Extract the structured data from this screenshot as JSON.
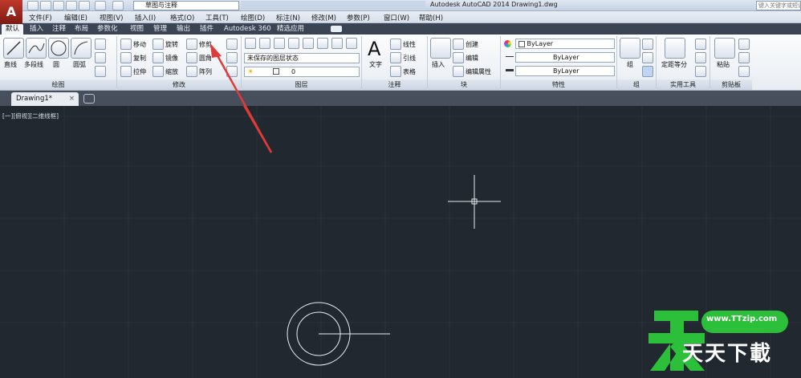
{
  "titlebar": {
    "workspace": "草图与注释",
    "title": "Autodesk AutoCAD 2014    Drawing1.dwg",
    "search_placeholder": "键入关键字或短语"
  },
  "menu": [
    "文件(F)",
    "编辑(E)",
    "视图(V)",
    "插入(I)",
    "格式(O)",
    "工具(T)",
    "绘图(D)",
    "标注(N)",
    "修改(M)",
    "参数(P)",
    "窗口(W)",
    "帮助(H)"
  ],
  "ribbon_tabs": [
    "默认",
    "插入",
    "注释",
    "布局",
    "参数化",
    "视图",
    "管理",
    "输出",
    "插件",
    "Autodesk 360",
    "精选应用"
  ],
  "draw_panel": {
    "line": "直线",
    "polyline": "多段线",
    "circle": "圆",
    "arc": "圆弧",
    "title": "绘图"
  },
  "modify_panel": {
    "move": "移动",
    "rotate": "旋转",
    "trim": "修剪",
    "copy": "复制",
    "mirror": "镜像",
    "fillet": "圆角",
    "stretch": "拉伸",
    "scale": "缩放",
    "array": "阵列",
    "title": "修改"
  },
  "layers_panel": {
    "state": "未保存的图层状态",
    "current": "0",
    "title": "图层"
  },
  "annotation_panel": {
    "text": "文字",
    "linear": "线性",
    "leader": "引线",
    "table": "表格",
    "title": "注释"
  },
  "block_panel": {
    "insert": "插入",
    "create": "创建",
    "edit": "编辑",
    "edit_attr": "编辑属性",
    "title": "块"
  },
  "properties_panel": {
    "color": "ByLayer",
    "linetype": "ByLayer",
    "lineweight": "ByLayer",
    "title": "特性"
  },
  "group_panel": {
    "group": "组",
    "title": "组"
  },
  "utilities_panel": {
    "measure": "定距等分",
    "title": "实用工具"
  },
  "clipboard_panel": {
    "paste": "粘贴",
    "title": "剪贴板"
  },
  "file_tab": "Drawing1*",
  "viewport_label": "[一][俯视][二维线框]",
  "watermark": {
    "url": "www.TTzip.com",
    "text": "天天下載"
  },
  "colors": {
    "canvas": "#212830",
    "arrow": "#e03a3a",
    "watermark": "#2bbf3a"
  }
}
